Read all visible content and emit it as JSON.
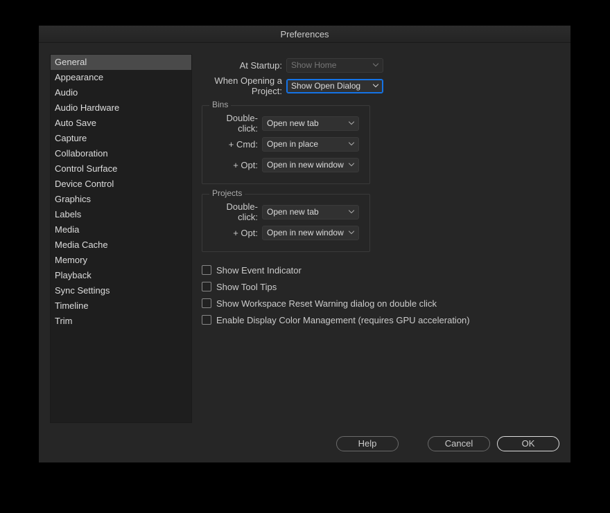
{
  "title": "Preferences",
  "sidebar": {
    "selected_index": 0,
    "items": [
      {
        "label": "General"
      },
      {
        "label": "Appearance"
      },
      {
        "label": "Audio"
      },
      {
        "label": "Audio Hardware"
      },
      {
        "label": "Auto Save"
      },
      {
        "label": "Capture"
      },
      {
        "label": "Collaboration"
      },
      {
        "label": "Control Surface"
      },
      {
        "label": "Device Control"
      },
      {
        "label": "Graphics"
      },
      {
        "label": "Labels"
      },
      {
        "label": "Media"
      },
      {
        "label": "Media Cache"
      },
      {
        "label": "Memory"
      },
      {
        "label": "Playback"
      },
      {
        "label": "Sync Settings"
      },
      {
        "label": "Timeline"
      },
      {
        "label": "Trim"
      }
    ]
  },
  "main": {
    "at_startup": {
      "label": "At Startup:",
      "value": "Show Home"
    },
    "when_opening": {
      "label": "When Opening a Project:",
      "value": "Show Open Dialog"
    },
    "bins": {
      "legend": "Bins",
      "double_click": {
        "label": "Double-click:",
        "value": "Open new tab"
      },
      "cmd": {
        "label": "+ Cmd:",
        "value": "Open in place"
      },
      "opt": {
        "label": "+ Opt:",
        "value": "Open in new window"
      }
    },
    "projects": {
      "legend": "Projects",
      "double_click": {
        "label": "Double-click:",
        "value": "Open new tab"
      },
      "opt": {
        "label": "+ Opt:",
        "value": "Open in new window"
      }
    },
    "checks": {
      "event_indicator": "Show Event Indicator",
      "tool_tips": "Show Tool Tips",
      "ws_reset": "Show Workspace Reset Warning dialog on double click",
      "color_mgmt": "Enable Display Color Management (requires GPU acceleration)"
    }
  },
  "footer": {
    "help": "Help",
    "cancel": "Cancel",
    "ok": "OK"
  }
}
